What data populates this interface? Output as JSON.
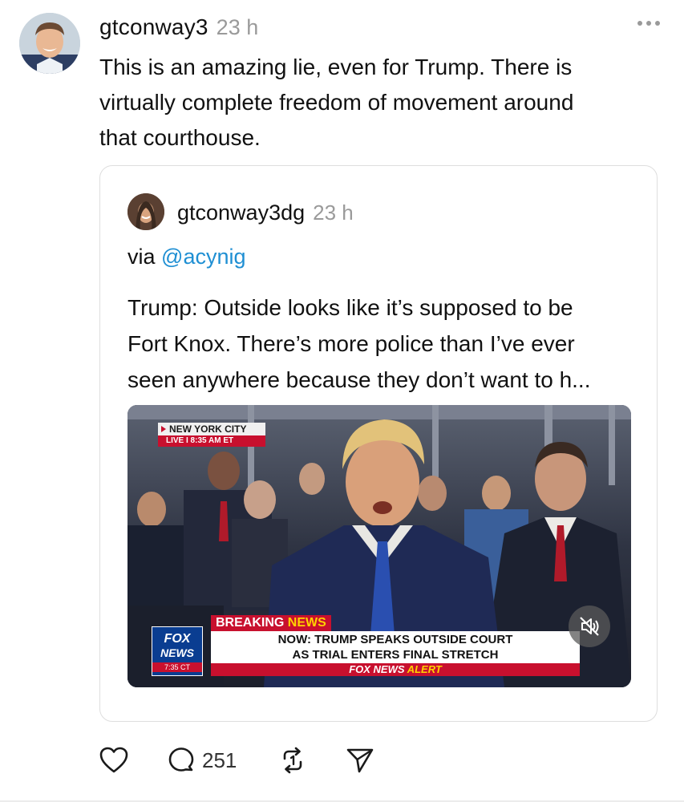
{
  "post": {
    "username": "gtconway3",
    "timestamp": "23 h",
    "text": "This is an amazing lie, even for Trump.  There is\nvirtually complete freedom of movement around\nthat courthouse."
  },
  "quoted_post": {
    "username": "gtconway3dg",
    "timestamp": "23 h",
    "via_prefix": "via ",
    "mention": "@acynig",
    "text": "Trump: Outside looks like it’s supposed to be\nFort Knox. There’s more police than I’ve ever\nseen anywhere because they don’t want to h...",
    "video": {
      "location_label": "NEW YORK CITY",
      "live_label": "LIVE  I  8:35 AM ET",
      "network_logo_line1": "FOX",
      "network_logo_line2": "NEWS",
      "network_time": "7:35 CT",
      "breaking_label": "BREAKING",
      "breaking_accent": "NEWS",
      "headline_line1": "NOW: TRUMP SPEAKS OUTSIDE COURT",
      "headline_line2": "AS TRIAL ENTERS FINAL STRETCH",
      "alert_label": "FOX NEWS",
      "alert_accent": "ALERT",
      "muted": true
    }
  },
  "actions": {
    "reply_count": "251"
  },
  "colors": {
    "mention": "#1f8fd3",
    "secondary_text": "#9a9a9a",
    "fox_red": "#c8102e",
    "fox_blue": "#0a3d91"
  },
  "icons": [
    "more-icon",
    "heart-icon",
    "reply-icon",
    "repost-icon",
    "share-icon",
    "speaker-muted-icon"
  ]
}
